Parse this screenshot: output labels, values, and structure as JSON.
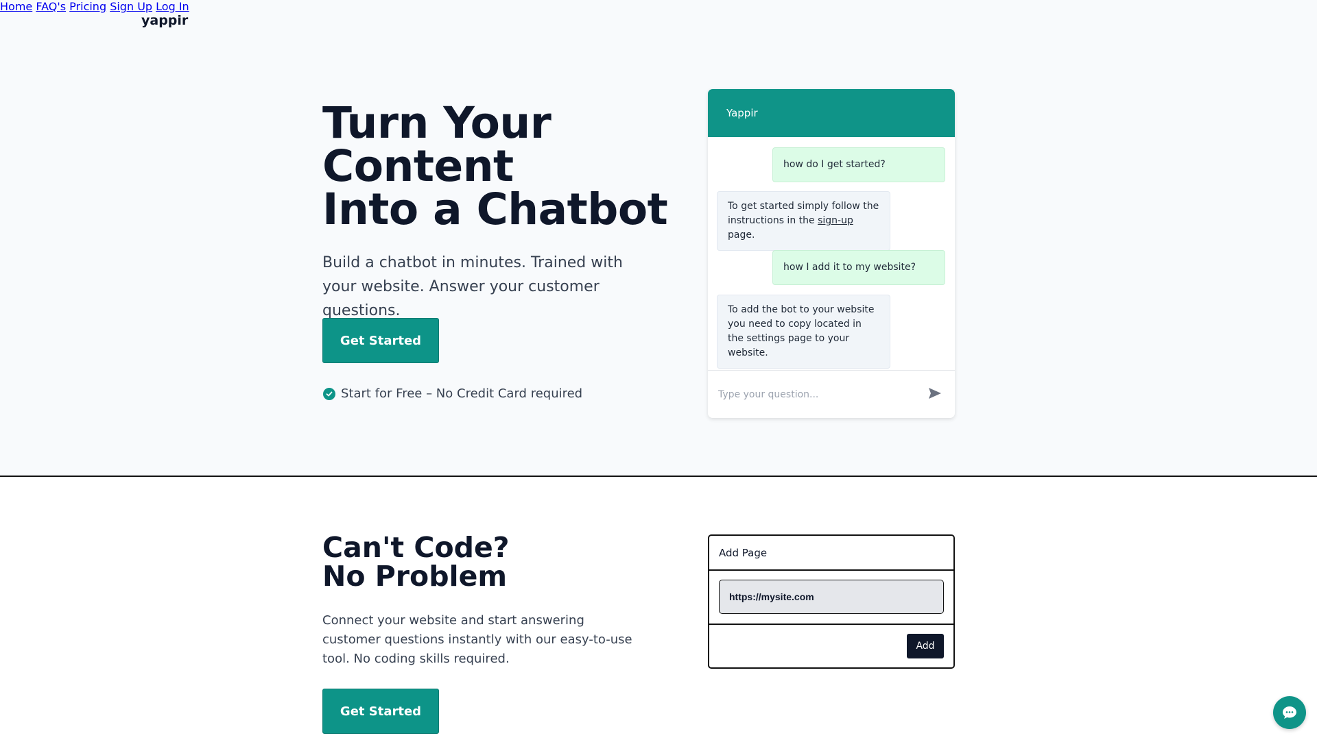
{
  "brand": {
    "logo": "yappir",
    "accent_color": "#0d9488"
  },
  "nav": {
    "items": [
      {
        "label": "Home"
      },
      {
        "label": "FAQ's"
      },
      {
        "label": "Pricing"
      },
      {
        "label": "Sign Up"
      },
      {
        "label": "Log In"
      }
    ]
  },
  "hero": {
    "title_line1": "Turn Your",
    "title_line2": "Content",
    "title_line3": "Into a Chatbot",
    "subtitle": "Build a chatbot in minutes. Trained with your website. Answer your customer questions.",
    "cta_label": "Get Started",
    "free_note": "Start for Free – No Credit Card required"
  },
  "chat_demo": {
    "header": "Yappir",
    "messages": [
      {
        "from": "user",
        "text": "how do I get started?"
      },
      {
        "from": "bot",
        "text_before": "To get started simply follow the instructions in the ",
        "link": "sign-up",
        "text_after": " page."
      },
      {
        "from": "user",
        "text": "how I add it to my website?"
      },
      {
        "from": "bot",
        "text": "To add the bot to your website you need to copy located in the settings page to your website."
      }
    ],
    "input_placeholder": "Type your question..."
  },
  "section2": {
    "title_line1": "Can't Code?",
    "title_line2": "No Problem",
    "subtitle": "Connect your website and start answering customer questions instantly with our easy-to-use tool. No coding skills required.",
    "cta_label": "Get Started"
  },
  "add_page": {
    "header": "Add Page",
    "url_value": "https://mysite.com",
    "add_label": "Add"
  },
  "icons": {
    "check": "check-circle-icon",
    "send": "send-icon",
    "chat_fab": "chat-bubble-icon"
  }
}
